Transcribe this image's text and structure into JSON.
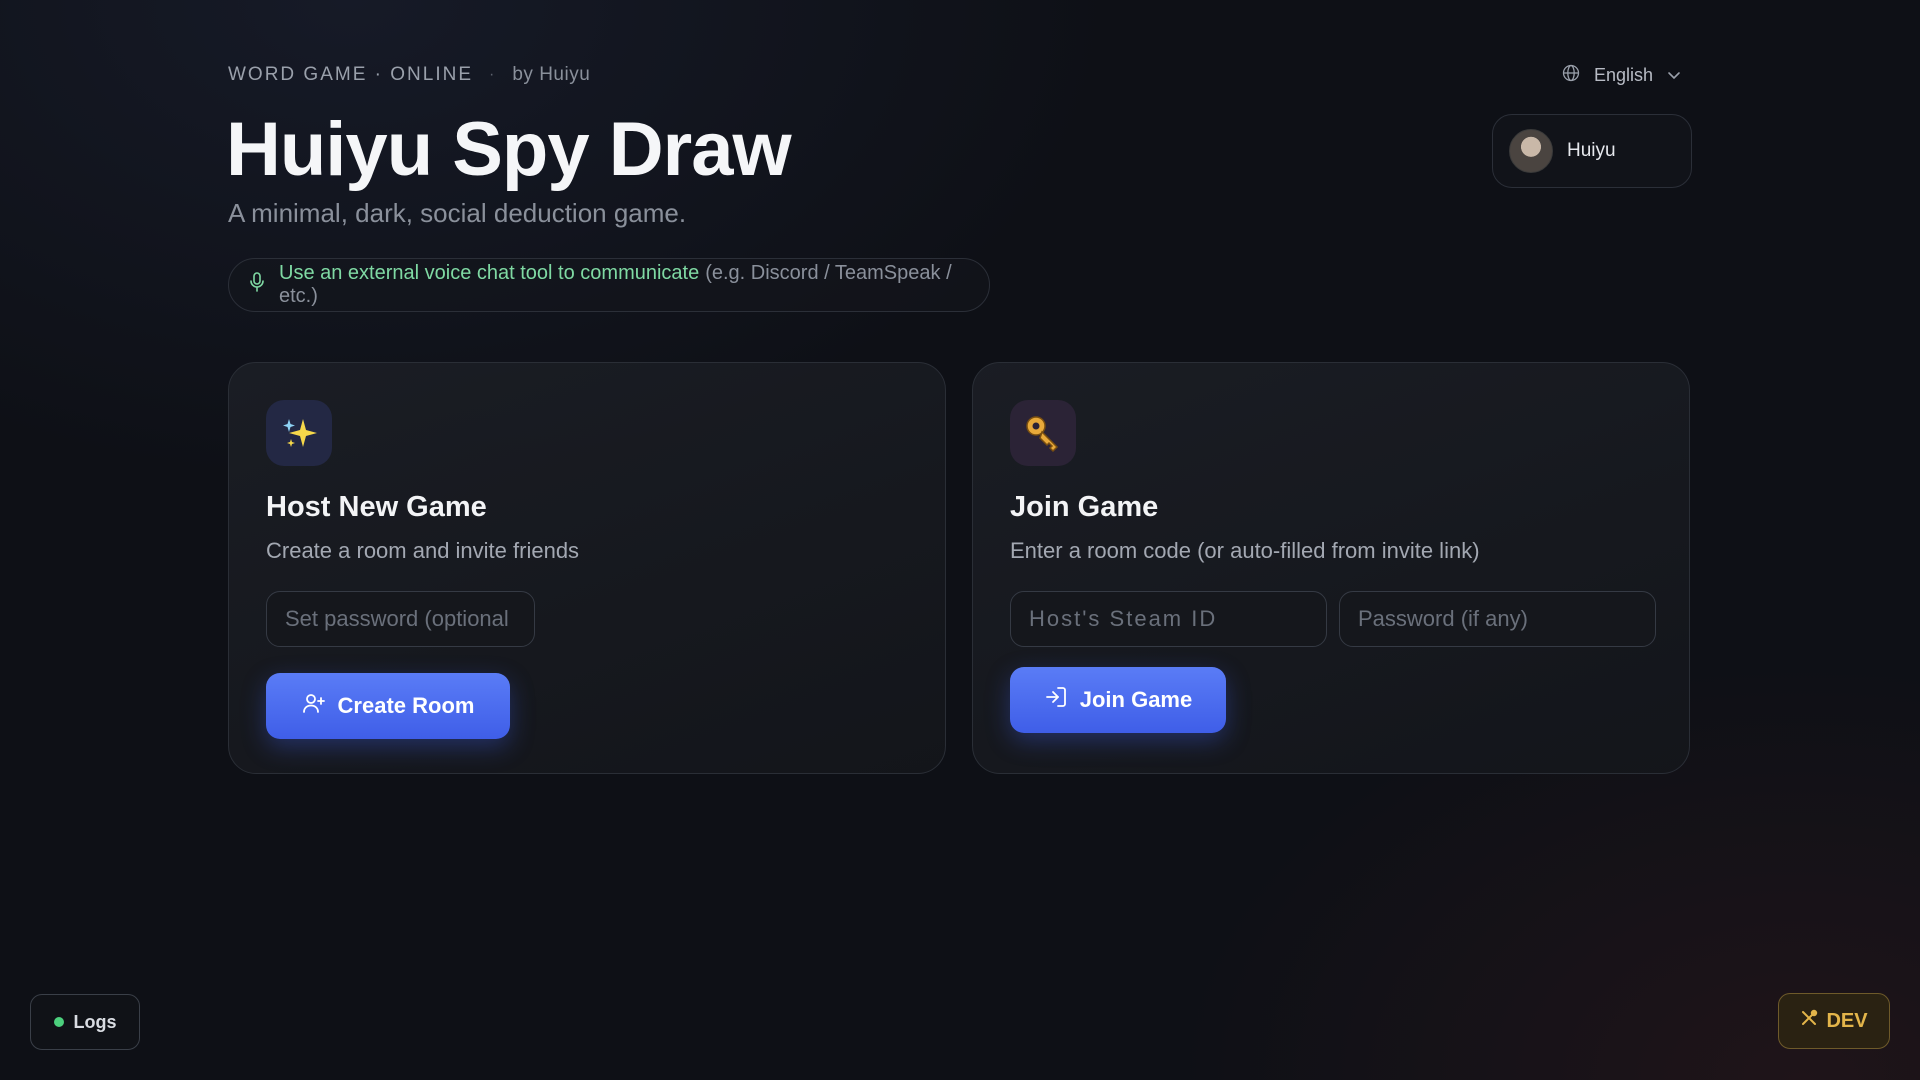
{
  "header": {
    "eyebrow": "WORD GAME · ONLINE",
    "separator": "·",
    "byline": "by Huiyu",
    "title": "Huiyu Spy Draw",
    "subtitle": "A minimal, dark, social deduction game.",
    "voice_note": "Use an external voice chat tool to communicate",
    "voice_examples": "(e.g. Discord / TeamSpeak / etc.)"
  },
  "language": {
    "label": "English",
    "icon": "globe-icon"
  },
  "user": {
    "name": "Huiyu"
  },
  "host_card": {
    "icon": "sparkles-icon",
    "title": "Host New Game",
    "description": "Create a room and invite friends",
    "password_placeholder": "Set password (optional",
    "button_label": "Create Room"
  },
  "join_card": {
    "icon": "key-icon",
    "title": "Join Game",
    "description": "Enter a room code (or auto-filled from invite link)",
    "steam_placeholder": "Host's Steam ID",
    "password_placeholder": "Password (if any)",
    "button_label": "Join Game"
  },
  "footer": {
    "logs_label": "Logs",
    "dev_label": "DEV"
  },
  "colors": {
    "accent": "#4a6cf0",
    "voice_green": "#7fd9a3",
    "dev_gold": "#e3b54a",
    "status_green": "#4cd07d"
  }
}
